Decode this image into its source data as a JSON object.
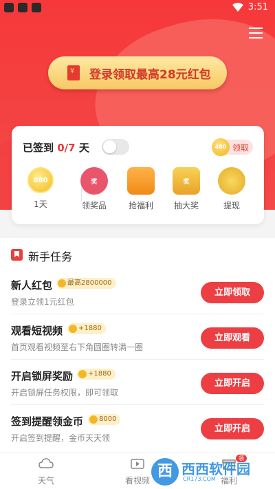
{
  "status": {
    "time": "3:51"
  },
  "header": {
    "login_banner": "登录领取最高28元红包"
  },
  "checkin": {
    "label_prefix": "已签到 ",
    "count": "0/7",
    "label_suffix": " 天",
    "coins": "480",
    "claim_label": "领取",
    "features": [
      {
        "icon": "coin-icon",
        "icon_text": "880",
        "label": "1天"
      },
      {
        "icon": "prize-bag-icon",
        "icon_text": "奖",
        "label": "领奖品"
      },
      {
        "icon": "gift-box-icon",
        "icon_text": "",
        "label": "抢福利"
      },
      {
        "icon": "lottery-icon",
        "icon_text": "奖",
        "label": "抽大奖"
      },
      {
        "icon": "coins-stack-icon",
        "icon_text": "",
        "label": "提现"
      }
    ]
  },
  "tasks": {
    "title": "新手任务",
    "items": [
      {
        "name": "新人红包",
        "reward": "最高2800000",
        "desc": "登录立领1元红包",
        "button": "立即领取"
      },
      {
        "name": "观看短视频",
        "reward": "+1880",
        "desc": "首页观看视频至右下角圆圈转满一圈",
        "button": "立即观看"
      },
      {
        "name": "开启锁屏奖励",
        "reward": "+1880",
        "desc": "开启锁屏任务权限，即可领取",
        "button": "立即开启"
      },
      {
        "name": "签到提醒领金币",
        "reward": "8000",
        "desc": "开启签到提醒，金币天天领",
        "button": "立即开启"
      }
    ]
  },
  "tabbar": {
    "items": [
      {
        "label": "天气",
        "icon": "cloud-icon"
      },
      {
        "label": "看视频",
        "icon": "video-icon"
      },
      {
        "label": "福利",
        "icon": "gift-icon",
        "badge": "领"
      }
    ]
  },
  "watermark": {
    "logo": "西",
    "name": "西西软件园",
    "url": "CR173.COM"
  },
  "colors": {
    "brand": "#f6383a",
    "accent": "#ed3f43",
    "gold": "#f7c863"
  }
}
